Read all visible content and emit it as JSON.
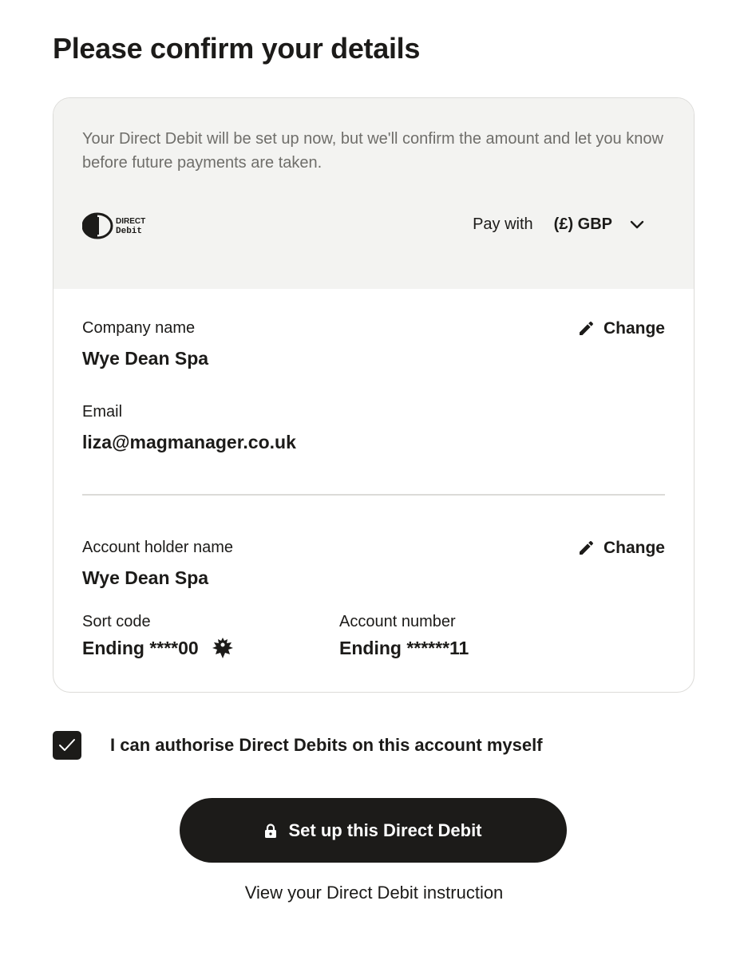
{
  "page": {
    "title": "Please confirm your details"
  },
  "summary": {
    "info_text": "Your Direct Debit will be set up now, but we'll confirm the amount and let you know before future payments are taken.",
    "logo_top": "DIRECT",
    "logo_bottom": "Debit",
    "pay_with_label": "Pay with",
    "currency_value": "(£) GBP"
  },
  "company": {
    "name_label": "Company name",
    "name_value": "Wye Dean Spa",
    "email_label": "Email",
    "email_value": "liza@magmanager.co.uk",
    "change_label": "Change"
  },
  "account": {
    "holder_label": "Account holder name",
    "holder_value": "Wye Dean Spa",
    "change_label": "Change",
    "sort_code_label": "Sort code",
    "sort_code_value": "Ending ****00",
    "account_number_label": "Account number",
    "account_number_value": "Ending ******11"
  },
  "authorise": {
    "checked": true,
    "label": "I can authorise Direct Debits on this account myself"
  },
  "actions": {
    "submit_label": "Set up this Direct Debit",
    "view_instruction_label": "View your Direct Debit instruction"
  },
  "colors": {
    "text": "#1c1b19",
    "muted_text": "#6f6e6a",
    "panel_bg": "#f3f3f1",
    "border": "#dcdbd8",
    "button_bg": "#1c1b19",
    "button_text": "#ffffff"
  },
  "icons": {
    "edit": "pencil-icon",
    "dropdown": "chevron-down-icon",
    "bank": "bank-eagle-icon",
    "lock": "lock-icon",
    "check": "checkmark-icon"
  }
}
